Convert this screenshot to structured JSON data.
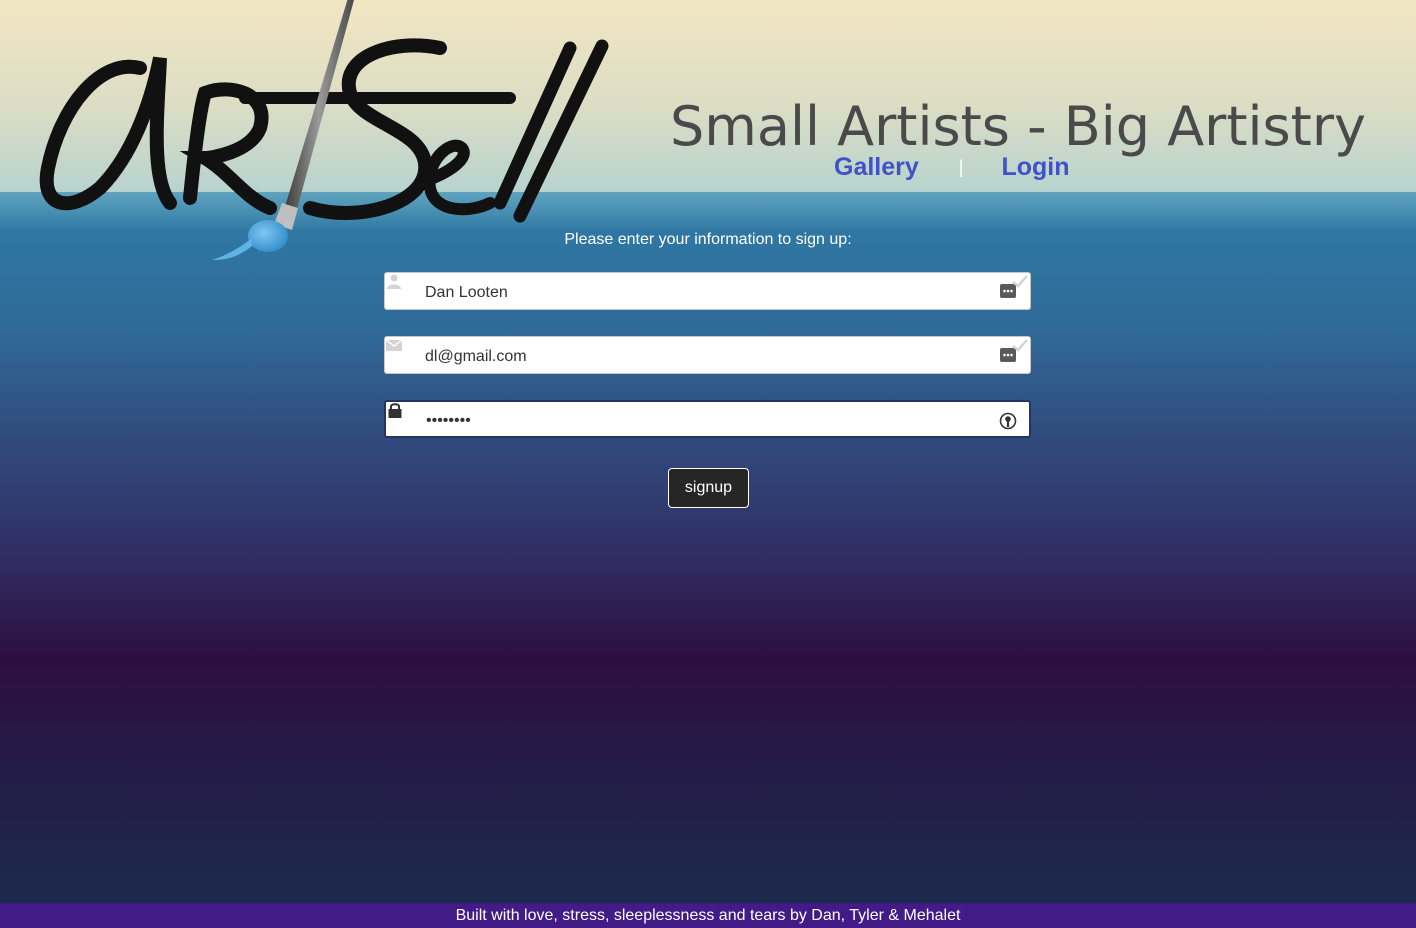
{
  "header": {
    "logo_text": "ArtSell",
    "tagline": "Small Artists - Big Artistry",
    "nav": {
      "gallery_label": "Gallery",
      "separator": "|",
      "login_label": "Login"
    }
  },
  "form": {
    "intro": "Please enter your information to sign up:",
    "name_field": {
      "value": "Dan Looten",
      "icon": "user-icon"
    },
    "email_field": {
      "value": "dl@gmail.com",
      "icon": "envelope-icon"
    },
    "password_field": {
      "value": "••••••••",
      "icon": "lock-icon"
    },
    "submit_label": "signup"
  },
  "footer": {
    "text": "Built with love, stress, sleeplessness and tears by Dan, Tyler & Mehalet"
  },
  "colors": {
    "nav_link": "#3f52c9",
    "footer_bg": "#431b87",
    "button_bg": "#262626",
    "tagline": "#4a4a4a"
  }
}
